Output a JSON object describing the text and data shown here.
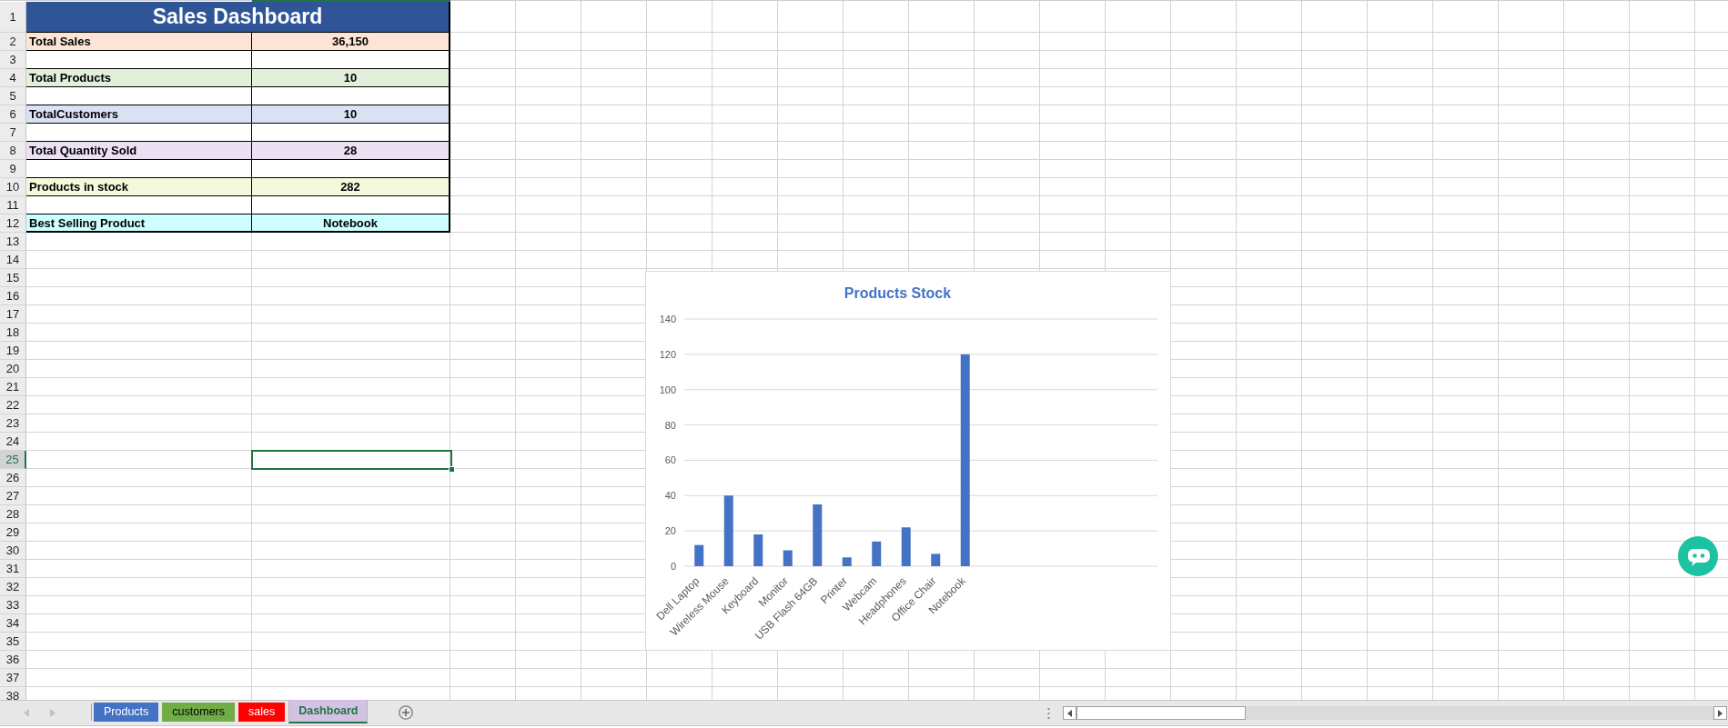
{
  "sheet": {
    "rows": [
      {
        "number": "1",
        "selected": false
      },
      {
        "number": "2",
        "selected": false
      },
      {
        "number": "3",
        "selected": false
      },
      {
        "number": "4",
        "selected": false
      },
      {
        "number": "5",
        "selected": false
      },
      {
        "number": "6",
        "selected": false
      },
      {
        "number": "7",
        "selected": false
      },
      {
        "number": "8",
        "selected": false
      },
      {
        "number": "9",
        "selected": false
      },
      {
        "number": "10",
        "selected": false
      },
      {
        "number": "11",
        "selected": false
      },
      {
        "number": "12",
        "selected": false
      },
      {
        "number": "13",
        "selected": false
      },
      {
        "number": "14",
        "selected": false
      },
      {
        "number": "15",
        "selected": false
      },
      {
        "number": "16",
        "selected": false
      },
      {
        "number": "17",
        "selected": false
      },
      {
        "number": "18",
        "selected": false
      },
      {
        "number": "19",
        "selected": false
      },
      {
        "number": "20",
        "selected": false
      },
      {
        "number": "21",
        "selected": false
      },
      {
        "number": "22",
        "selected": false
      },
      {
        "number": "23",
        "selected": false
      },
      {
        "number": "24",
        "selected": false
      },
      {
        "number": "25",
        "selected": true
      },
      {
        "number": "26",
        "selected": false
      },
      {
        "number": "27",
        "selected": false
      },
      {
        "number": "28",
        "selected": false
      },
      {
        "number": "29",
        "selected": false
      },
      {
        "number": "30",
        "selected": false
      },
      {
        "number": "31",
        "selected": false
      },
      {
        "number": "32",
        "selected": false
      },
      {
        "number": "33",
        "selected": false
      },
      {
        "number": "34",
        "selected": false
      },
      {
        "number": "35",
        "selected": false
      },
      {
        "number": "36",
        "selected": false
      },
      {
        "number": "37",
        "selected": false
      },
      {
        "number": "38",
        "selected": false
      }
    ],
    "dashboard": {
      "title": "Sales Dashboard",
      "metrics": [
        {
          "label": "Total Sales",
          "value": "36,150",
          "color": "#fce4d6"
        },
        {
          "label": "Total Products",
          "value": "10",
          "color": "#e2efda"
        },
        {
          "label": "TotalCustomers",
          "value": "10",
          "color": "#d9e1f2"
        },
        {
          "label": "Total Quantity Sold",
          "value": "28",
          "color": "#ebe1f3"
        },
        {
          "label": "Products in stock",
          "value": "282",
          "color": "#f6f8dc"
        },
        {
          "label": "Best Selling Product",
          "value": "Notebook",
          "color": "#ccffff"
        }
      ]
    },
    "chart": {
      "chart_data": {
        "type": "bar",
        "title": "Products Stock",
        "categories": [
          "Dell Laptop",
          "Wireless Mouse",
          "Keyboard",
          "Monitor",
          "USB Flash 64GB",
          "Printer",
          "Webcam",
          "Headphones",
          "Office Chair",
          "Notebook"
        ],
        "values": [
          12,
          40,
          18,
          9,
          35,
          5,
          14,
          22,
          7,
          120
        ],
        "ylim": [
          0,
          140
        ],
        "yticks": [
          0,
          20,
          40,
          60,
          80,
          100,
          120,
          140
        ],
        "grid": true
      }
    }
  },
  "sheet_tabs": [
    {
      "label": "Products",
      "color": "#4472c4",
      "selected": false
    },
    {
      "label": "customers",
      "color": "#70ad47",
      "selected": false
    },
    {
      "label": "sales",
      "color": "#ff0000",
      "selected": false
    },
    {
      "label": "Dashboard",
      "color": "#d4c2e4",
      "selected": true
    }
  ]
}
